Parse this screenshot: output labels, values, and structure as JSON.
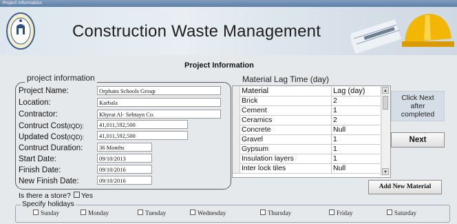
{
  "window": {
    "title": "Project Information"
  },
  "header": {
    "app_title": "Construction Waste Management"
  },
  "page": {
    "heading": "Project Information"
  },
  "project_info": {
    "group_title": "project information",
    "fields": [
      {
        "label": "Project Name:",
        "value": "Orphans Schools Group"
      },
      {
        "label": "Location:",
        "value": "Karbala"
      },
      {
        "label": "Contractor:",
        "value": "Khyrat Al- Sebtayn Co."
      },
      {
        "label": "Contruct Cost",
        "label_small": "(IQD):",
        "value": "41,011,592,500"
      },
      {
        "label": "Updated Cost",
        "label_small": "(IQD):",
        "value": "41,011,592,500"
      },
      {
        "label": "Contruct Duration:",
        "value": "36 Months"
      },
      {
        "label": "Start Date:",
        "value": "09/10/2013"
      },
      {
        "label": "Finish Date:",
        "value": "09/10/2016"
      },
      {
        "label": "New Finish Date:",
        "value": "09/10/2016"
      }
    ]
  },
  "material_lag": {
    "title": "Material Lag Time (day)",
    "columns": [
      "Material",
      "Lag (day)"
    ],
    "rows": [
      {
        "material": "Brick",
        "lag": "2"
      },
      {
        "material": "Cement",
        "lag": "1"
      },
      {
        "material": "Ceramics",
        "lag": "2"
      },
      {
        "material": "Concrete",
        "lag": "Null"
      },
      {
        "material": "Gravel",
        "lag": "1"
      },
      {
        "material": "Gypsum",
        "lag": "1"
      },
      {
        "material": "Insulation layers",
        "lag": "1"
      },
      {
        "material": "Inter lock tiles",
        "lag": "Null"
      }
    ]
  },
  "hint": {
    "line1": "Click Next",
    "line2": "after",
    "line3": "completed"
  },
  "buttons": {
    "next": "Next",
    "add_material": "Add New Material"
  },
  "store": {
    "question": "Is there a store?",
    "option": "Yes"
  },
  "holidays": {
    "title": "Specify holidays",
    "days": [
      "Sunday",
      "Monday",
      "Tuesday",
      "Wednesday",
      "Thursday",
      "Friday",
      "Saturday"
    ]
  },
  "colors": {
    "background": "#e6e9ec",
    "banner": "#dde6ee",
    "title_text": "#1d1d1d",
    "helmet": "#f2b705"
  }
}
